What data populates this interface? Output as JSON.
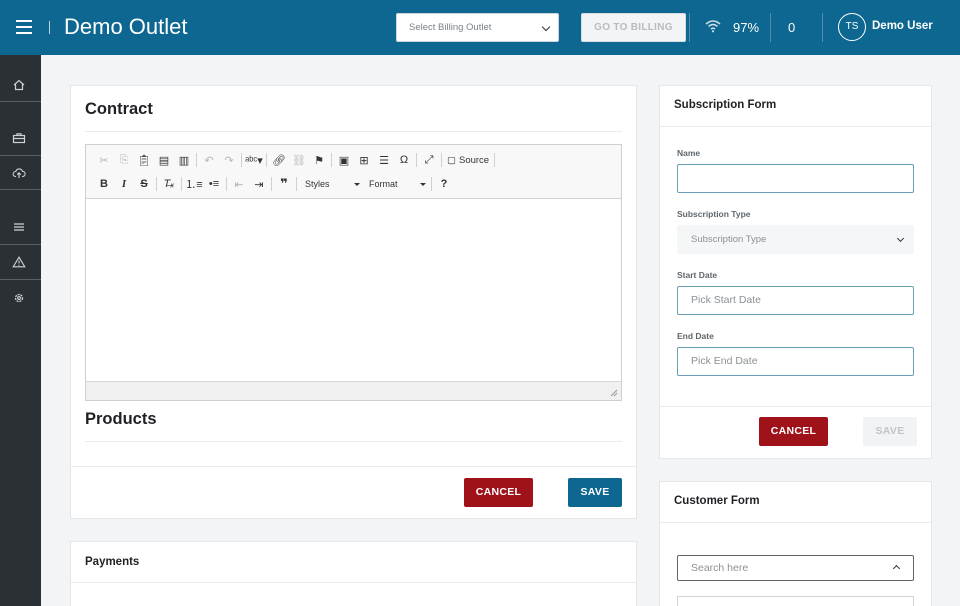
{
  "header": {
    "title": "Demo Outlet",
    "outlet_select_placeholder": "Select Billing Outlet",
    "goto_billing_label": "GO TO BILLING",
    "battery": "97%",
    "notifications": "0",
    "avatar_initials": "TS",
    "user_name": "Demo User"
  },
  "sidebar": {
    "items": [
      {
        "icon": "home-icon"
      },
      {
        "icon": "briefcase-icon"
      },
      {
        "icon": "cloud-upload-icon"
      },
      {
        "icon": "list-icon"
      },
      {
        "icon": "warning-icon"
      },
      {
        "icon": "gear-icon"
      }
    ]
  },
  "contract": {
    "title": "Contract",
    "toolbar": {
      "source_label": "Source",
      "styles_label": "Styles",
      "format_label": "Format"
    },
    "products_title": "Products",
    "cancel_label": "CANCEL",
    "save_label": "SAVE"
  },
  "payments": {
    "title": "Payments"
  },
  "subscription_form": {
    "title": "Subscription Form",
    "name_label": "Name",
    "name_value": "",
    "type_label": "Subscription Type",
    "type_placeholder": "Subscription Type",
    "start_label": "Start Date",
    "start_placeholder": "Pick Start Date",
    "end_label": "End Date",
    "end_placeholder": "Pick End Date",
    "cancel_label": "CANCEL",
    "save_label": "SAVE"
  },
  "customer_form": {
    "title": "Customer Form",
    "search_placeholder": "Search here"
  },
  "colors": {
    "brand": "#0d6790",
    "cancel": "#a0121a",
    "sidebar": "#2b3035"
  }
}
